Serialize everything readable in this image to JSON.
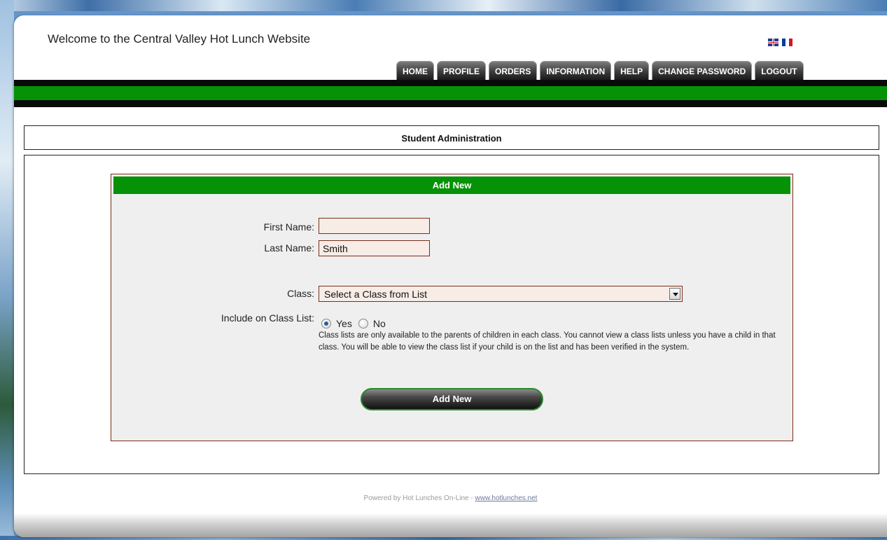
{
  "site": {
    "welcome": "Welcome to the Central Valley Hot Lunch Website",
    "languages": [
      {
        "name": "English",
        "icon": "uk-flag-icon"
      },
      {
        "name": "French",
        "icon": "france-flag-icon"
      }
    ]
  },
  "nav": {
    "tabs": [
      "HOME",
      "PROFILE",
      "ORDERS",
      "INFORMATION",
      "HELP",
      "CHANGE PASSWORD",
      "LOGOUT"
    ]
  },
  "page": {
    "title": "Student Administration"
  },
  "form": {
    "header": "Add New",
    "first_name_label": "First Name:",
    "first_name_value": "",
    "last_name_label": "Last Name:",
    "last_name_value": "Smith",
    "class_label": "Class:",
    "class_selected": "Select a Class from List",
    "include_label": "Include on Class List:",
    "option_yes": "Yes",
    "option_no": "No",
    "selected_option": "Yes",
    "note": "Class lists are only available to the parents of children in each class. You cannot view a class lists unless you have a child in that class. You will be able to view the class list if your child is on the list and has been verified in the system.",
    "submit_label": "Add New"
  },
  "footer": {
    "text": "Powered by Hot Lunches On-Line - ",
    "link_text": "www.hotlunches.net"
  },
  "colors": {
    "brand_green": "#069206",
    "border_brown": "#7b2e18",
    "input_bg": "#f8ece6"
  }
}
